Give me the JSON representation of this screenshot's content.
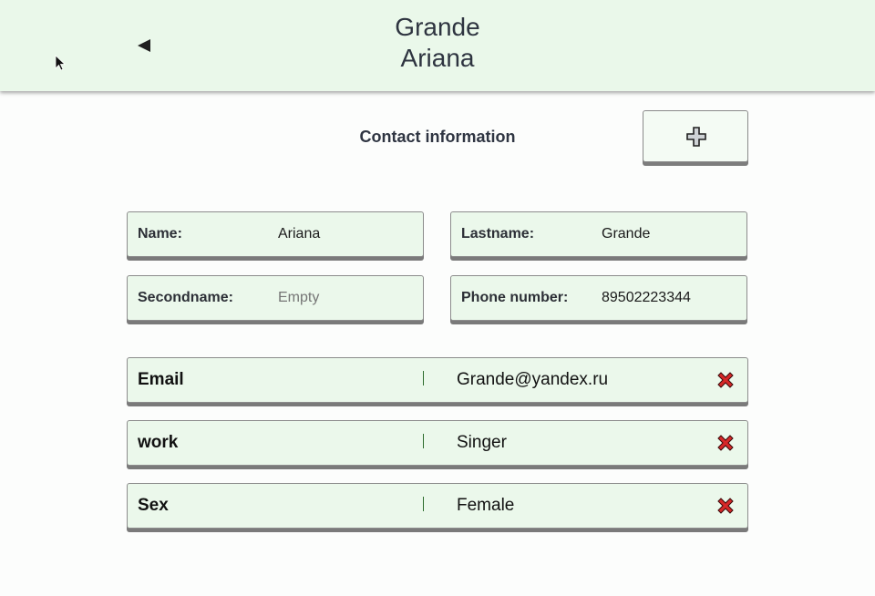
{
  "header": {
    "title_line1": "Grande",
    "title_line2": "Ariana",
    "back_icon": "back-triangle-icon"
  },
  "section": {
    "title": "Contact information",
    "add_icon": "plus-icon"
  },
  "fields": [
    {
      "label": "Name:",
      "value": "Ariana",
      "placeholder": ""
    },
    {
      "label": "Lastname:",
      "value": "Grande",
      "placeholder": ""
    },
    {
      "label": "Secondname:",
      "value": "",
      "placeholder": "Empty"
    },
    {
      "label": "Phone number:",
      "value": "89502223344",
      "placeholder": ""
    }
  ],
  "extra_rows": [
    {
      "key": "Email",
      "value": "Grande@yandex.ru"
    },
    {
      "key": "work",
      "value": "Singer"
    },
    {
      "key": "Sex",
      "value": "Female"
    }
  ],
  "colors": {
    "header_bg": "#eaf8ea",
    "field_bg": "#ebf8eb",
    "delete_red": "#d62828"
  }
}
